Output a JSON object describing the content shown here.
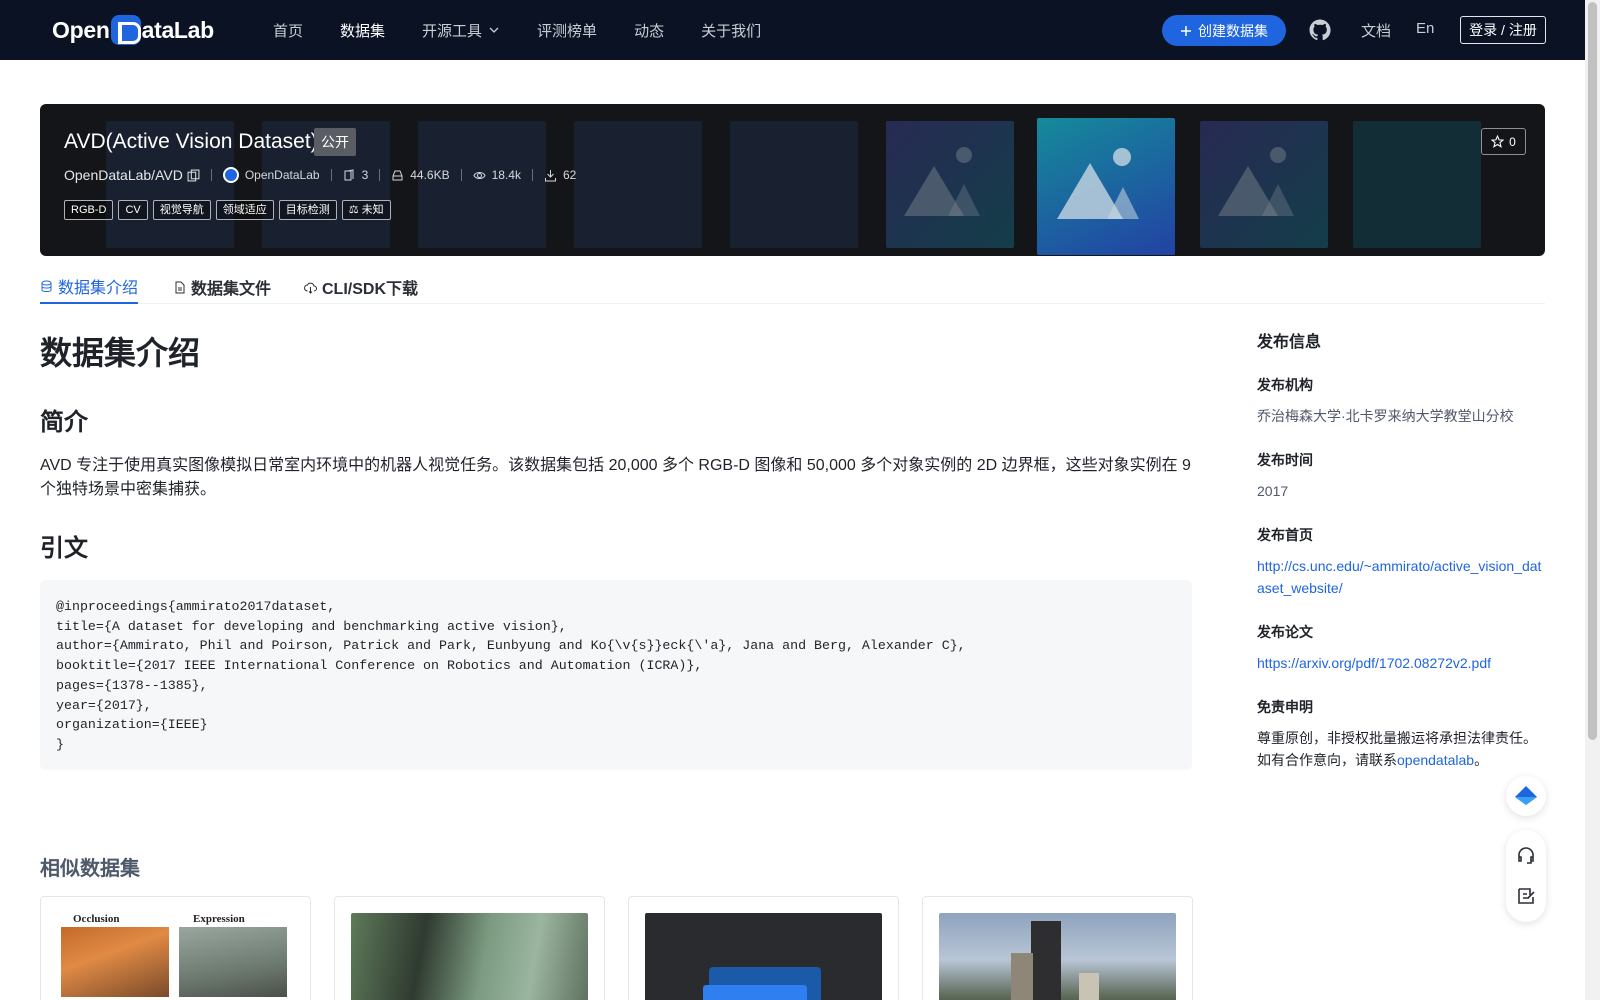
{
  "brand": {
    "logo_pre": "Open",
    "logo_post": "ataLab"
  },
  "nav": {
    "home": "首页",
    "datasets": "数据集",
    "tools": "开源工具",
    "leaderboard": "评测榜单",
    "news": "动态",
    "about": "关于我们",
    "create": "创建数据集",
    "docs": "文档",
    "lang": "En",
    "login": "登录 / 注册"
  },
  "dataset": {
    "title": "AVD(Active Vision Dataset)",
    "visibility": "公开",
    "path": "OpenDataLab/AVD",
    "org": "OpenDataLab",
    "files": "3",
    "size": "44.6KB",
    "views": "18.4k",
    "downloads": "62",
    "tags": [
      "RGB-D",
      "CV",
      "视觉导航",
      "领域适应",
      "目标检测"
    ],
    "license": "未知",
    "stars": "0"
  },
  "tabs": {
    "intro": "数据集介绍",
    "files": "数据集文件",
    "cli": "CLI/SDK下载"
  },
  "content": {
    "heading": "数据集介绍",
    "intro_heading": "简介",
    "intro_text": "AVD 专注于使用真实图像模拟日常室内环境中的机器人视觉任务。该数据集包括 20,000 多个 RGB-D 图像和 50,000 多个对象实例的 2D 边界框，这些对象实例在 9 个独特场景中密集捕获。",
    "citation_heading": "引文",
    "citation": "@inproceedings{ammirato2017dataset,\ntitle={A dataset for developing and benchmarking active vision},\nauthor={Ammirato, Phil and Poirson, Patrick and Park, Eunbyung and Ko{\\v{s}}eck{\\'a}, Jana and Berg, Alexander C},\nbooktitle={2017 IEEE International Conference on Robotics and Automation (ICRA)},\npages={1378--1385},\nyear={2017},\norganization={IEEE}\n}",
    "similar_heading": "相似数据集",
    "card1_labels": [
      "Occlusion",
      "Expression"
    ]
  },
  "sidebar": {
    "title": "发布信息",
    "org_label": "发布机构",
    "org_value": "乔治梅森大学·北卡罗来纳大学教堂山分校",
    "time_label": "发布时间",
    "time_value": "2017",
    "home_label": "发布首页",
    "home_value": "http://cs.unc.edu/~ammirato/active_vision_dataset_website/",
    "paper_label": "发布论文",
    "paper_value": "https://arxiv.org/pdf/1702.08272v2.pdf",
    "disclaimer_label": "免责申明",
    "disclaimer_text": "尊重原创，非授权批量搬运将承担法律责任。如有合作意向，请联系",
    "disclaimer_link": "opendatalab",
    "disclaimer_end": "。"
  },
  "colors": {
    "accent": "#1f65e0",
    "nav_bg": "#0a1224",
    "hero_bg": "#141518"
  }
}
